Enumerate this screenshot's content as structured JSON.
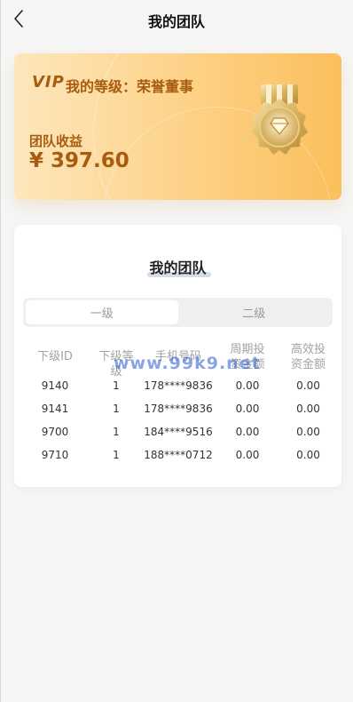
{
  "header": {
    "title": "我的团队"
  },
  "vip_card": {
    "logo": "VIP",
    "level_text": "我的等级：荣誉董事",
    "earnings_label": "团队收益",
    "earnings_amount": "¥ 397.60"
  },
  "team": {
    "title": "我的团队",
    "tabs": [
      {
        "label": "一级",
        "active": true
      },
      {
        "label": "二级",
        "active": false
      }
    ],
    "columns": [
      "下级ID",
      "下级等级",
      "手机号码",
      "周期投资金额",
      "高效投资金额"
    ],
    "rows": [
      {
        "id": "9140",
        "level": "1",
        "phone": "178****9836",
        "cycle": "0.00",
        "efficient": "0.00"
      },
      {
        "id": "9141",
        "level": "1",
        "phone": "178****9836",
        "cycle": "0.00",
        "efficient": "0.00"
      },
      {
        "id": "9700",
        "level": "1",
        "phone": "184****9516",
        "cycle": "0.00",
        "efficient": "0.00"
      },
      {
        "id": "9710",
        "level": "1",
        "phone": "188****0712",
        "cycle": "0.00",
        "efficient": "0.00"
      }
    ]
  },
  "watermark": "www.99k9.net",
  "colors": {
    "accent": "#a85c10",
    "card_start": "#fde7bd",
    "card_end": "#fcbf5c"
  }
}
